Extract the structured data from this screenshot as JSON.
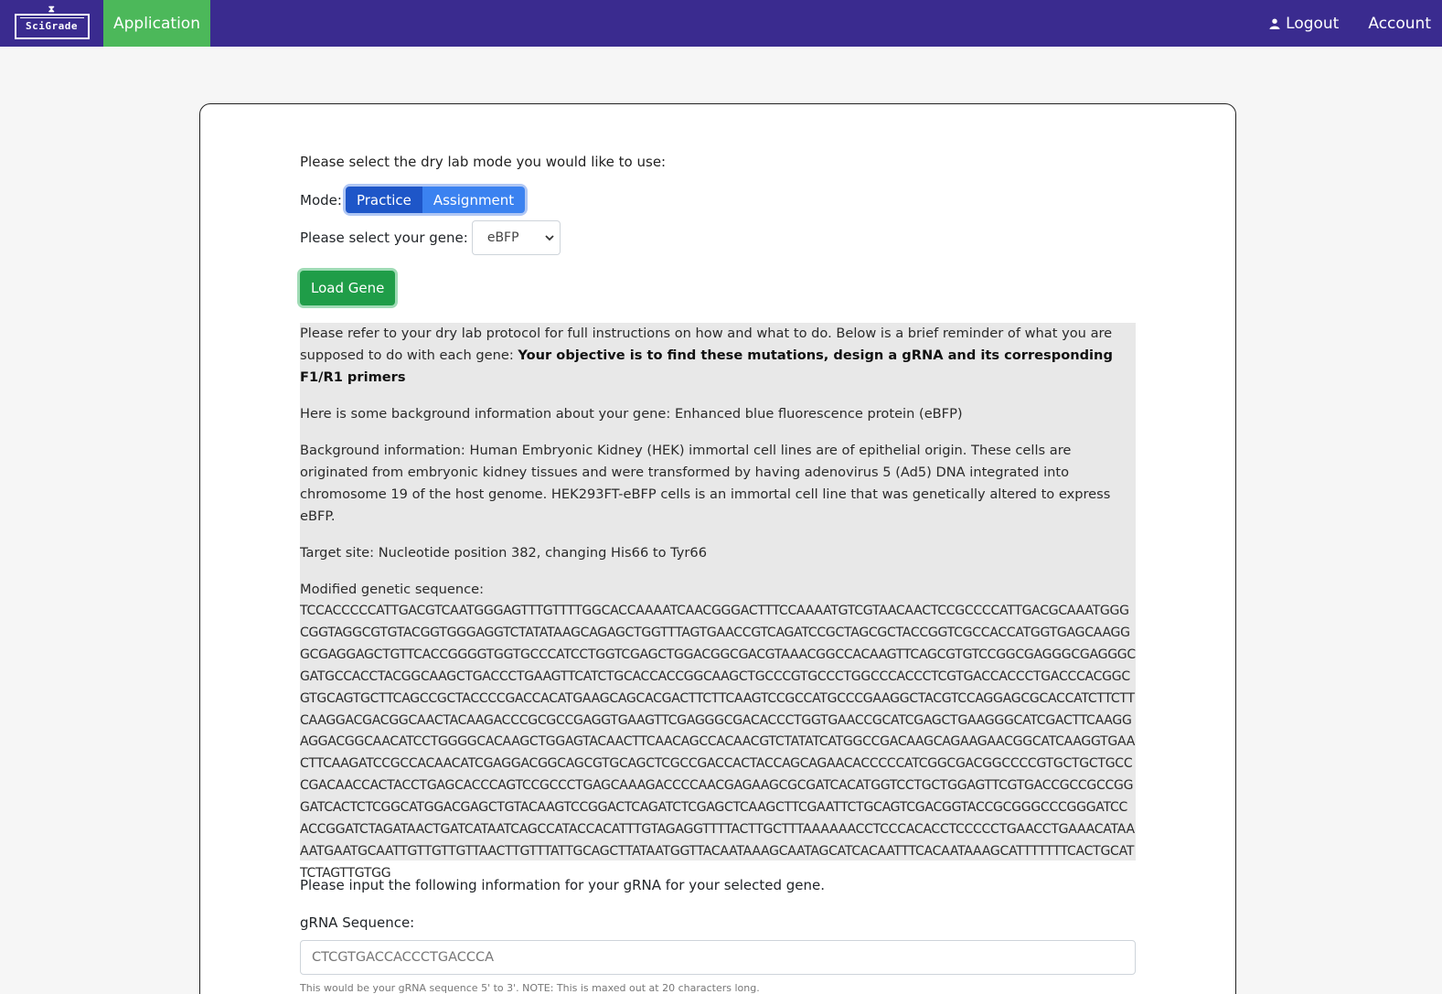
{
  "nav": {
    "brand": "SciGrade",
    "app_label": "Application",
    "logout_label": "Logout",
    "account_label": "Account"
  },
  "form": {
    "select_prompt": "Please select the dry lab mode you would like to use:",
    "mode_label": "Mode:",
    "mode_options": [
      "Practice",
      "Assignment"
    ],
    "mode_selected": "Practice",
    "gene_label": "Please select your gene:",
    "gene_value": "eBFP",
    "load_button": "Load Gene"
  },
  "info": {
    "intro": "Please refer to your dry lab protocol for full instructions on how and what to do. Below is a brief reminder of what you are supposed to do with each gene: ",
    "objective": "Your objective is to find these mutations, design a gRNA and its corresponding F1/R1 primers",
    "background_gene": "Here is some background information about your gene: Enhanced blue fluorescence protein (eBFP)",
    "background_info": "Background information: Human Embryonic Kidney (HEK) immortal cell lines are of epithelial origin. These cells are originated from embryonic kidney tissues and were transformed by having adenovirus 5 (Ad5) DNA integrated into chromosome 19 of the host genome. HEK293FT-eBFP cells is an immortal cell line that was genetically altered to express eBFP.",
    "target_site": "Target site: Nucleotide position 382, changing His66 to Tyr66",
    "sequence_label": "Modified genetic sequence:",
    "sequence": "TCCACCCCCATTGACGTCAATGGGAGTTTGTTTTGGCACCAAAATCAACGGGACTTTCCAAAATGTCGTAACAACTCCGCCCCATTGACGCAAATGGGCGGTAGGCGTGTACGGTGGGAGGTCTATATAAGCAGAGCTGGTTTAGTGAACCGTCAGATCCGCTAGCGCTACCGGTCGCCACCATGGTGAGCAAGGGCGAGGAGCTGTTCACCGGGGTGGTGCCCATCCTGGTCGAGCTGGACGGCGACGTAAACGGCCACAAGTTCAGCGTGTCCGGCGAGGGCGAGGGCGATGCCACCTACGGCAAGCTGACCCTGAAGTTCATCTGCACCACCGGCAAGCTGCCCGTGCCCTGGCCCACCCTCGTGACCACCCTGACCCACGGCGTGCAGTGCTTCAGCCGCTACCCCGACCACATGAAGCAGCACGACTTCTTCAAGTCCGCCATGCCCGAAGGCTACGTCCAGGAGCGCACCATCTTCTTCAAGGACGACGGCAACTACAAGACCCGCGCCGAGGTGAAGTTCGAGGGCGACACCCTGGTGAACCGCATCGAGCTGAAGGGCATCGACTTCAAGGAGGACGGCAACATCCTGGGGCACAAGCTGGAGTACAACTTCAACAGCCACAACGTCTATATCATGGCCGACAAGCAGAAGAACGGCATCAAGGTGAACTTCAAGATCCGCCACAACATCGAGGACGGCAGCGTGCAGCTCGCCGACCACTACCAGCAGAACACCCCCATCGGCGACGGCCCCGTGCTGCTGCCCGACAACCACTACCTGAGCACCCAGTCCGCCCTGAGCAAAGACCCCAACGAGAAGCGCGATCACATGGTCCTGCTGGAGTTCGTGACCGCCGCCGGGATCACTCTCGGCATGGACGAGCTGTACAAGTCCGGACTCAGATCTCGAGCTCAAGCTTCGAATTCTGCAGTCGACGGTACCGCGGGCCCGGGATCCACCGGATCTAGATAACTGATCATAATCAGCCATACCACATTTGTAGAGGTTTTACTTGCTTTAAAAAACCTCCCACACCTCCCCCTGAACCTGAAACATAAAATGAATGCAATTGTTGTTGTTAACTTGTTTATTGCAGCTTATAATGGTTACAATAAAGCAATAGCATCACAATTTCACAATAAAGCATTTTTTTCACTGCATTCTAGTTGTGG"
  },
  "grna": {
    "intro": "Please input the following information for your gRNA for your selected gene.",
    "label": "gRNA Sequence:",
    "value": "CTCGTGACCACCCTGACCCA",
    "help": "This would be your gRNA sequence 5' to 3'. NOTE: This is maxed out at 20 characters long."
  }
}
